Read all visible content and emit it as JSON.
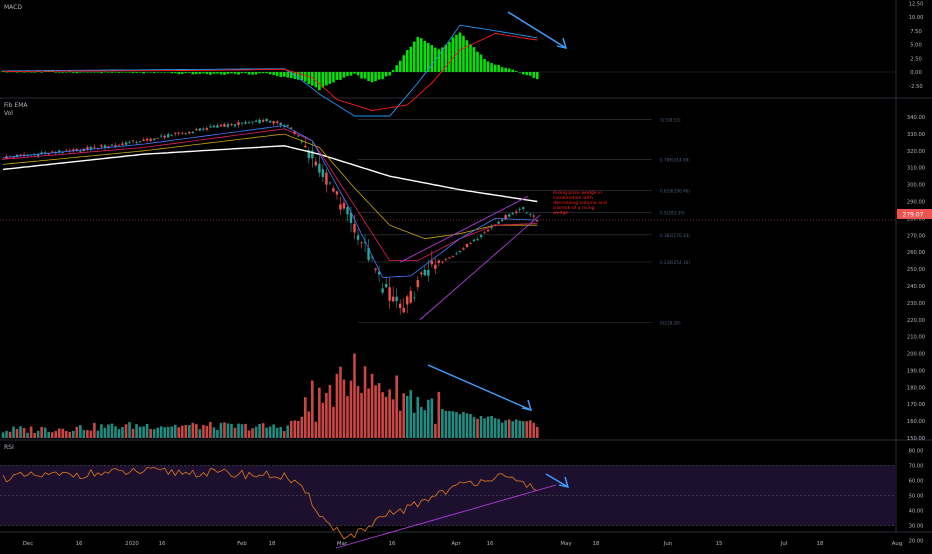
{
  "panes": {
    "macd": {
      "label": "MACD"
    },
    "price": {
      "label": "Fib EMA",
      "sublabel": "Vol"
    },
    "rsi": {
      "label": "RSI"
    }
  },
  "current_price": "279.07",
  "annotation": [
    "Rising price wedge in",
    "combination with",
    "decreasing volume and",
    "a break of a rising",
    "wedge"
  ],
  "fib_levels": [
    {
      "label": "1(338.53)",
      "value": 338.5
    },
    {
      "label": "0.786(314.99)",
      "value": 315.0
    },
    {
      "label": "0.618(296.46)",
      "value": 296.5
    },
    {
      "label": "0.5(283.39)",
      "value": 283.4
    },
    {
      "label": "0.382(270.33)",
      "value": 270.3
    },
    {
      "label": "0.236(254.16)",
      "value": 254.2
    },
    {
      "label": "0(218.26)",
      "value": 218.3
    }
  ],
  "axes": {
    "macd_ticks": [
      "12.50",
      "10.00",
      "7.50",
      "5.00",
      "2.50",
      "0.00",
      "-2.50"
    ],
    "price_ticks": [
      "340.00",
      "330.00",
      "320.00",
      "310.00",
      "300.00",
      "290.00",
      "280.00",
      "270.00",
      "260.00",
      "250.00",
      "240.00",
      "230.00",
      "220.00",
      "210.00",
      "200.00",
      "190.00",
      "180.00",
      "170.00",
      "160.00",
      "150.00"
    ],
    "rsi_ticks": [
      "80.00",
      "70.00",
      "60.00",
      "50.00",
      "40.00",
      "30.00",
      "20.00"
    ],
    "x_ticks": [
      "Dec",
      "16",
      "2020",
      "16",
      "Feb",
      "18",
      "Mar",
      "16",
      "Apr",
      "16",
      "May",
      "18",
      "Jun",
      "15",
      "Jul",
      "18",
      "Aug"
    ]
  },
  "colors": {
    "up": "#26a69a",
    "down": "#ef5350",
    "macd_hist": "#00e500",
    "macd_line": "#2196f3",
    "signal_line": "#ff1a1a",
    "ema_200": "#ffffff",
    "ema_fast": "#4a78ff",
    "ema_mid": "#e91e63",
    "ema_slow": "#c8a800",
    "rsi_line": "#e07a1f",
    "rsi_band": "#1d0f2e",
    "wedge": "#b03cd8",
    "arrow": "#3fa0ff",
    "annotation": "#ff2020"
  },
  "chart_data": {
    "type": "candlestick",
    "scale": {
      "price_range": [
        150,
        343
      ],
      "macd_range": [
        -4,
        13
      ],
      "rsi_range": [
        15,
        85
      ]
    },
    "anchors": {
      "price": [
        [
          0,
          316
        ],
        [
          20,
          320
        ],
        [
          40,
          326
        ],
        [
          60,
          334
        ],
        [
          75,
          338
        ],
        [
          82,
          334
        ],
        [
          90,
          310
        ],
        [
          100,
          276
        ],
        [
          108,
          240
        ],
        [
          114,
          226
        ],
        [
          120,
          248
        ],
        [
          128,
          258
        ],
        [
          136,
          270
        ],
        [
          143,
          281
        ],
        [
          148,
          286
        ],
        [
          152,
          279
        ]
      ],
      "ema200": [
        [
          0,
          309
        ],
        [
          40,
          318
        ],
        [
          80,
          323
        ],
        [
          90,
          318
        ],
        [
          110,
          305
        ],
        [
          130,
          297
        ],
        [
          152,
          290
        ]
      ],
      "ema_slow": [
        [
          0,
          312
        ],
        [
          40,
          320
        ],
        [
          80,
          330
        ],
        [
          90,
          322
        ],
        [
          100,
          298
        ],
        [
          110,
          276
        ],
        [
          120,
          268
        ],
        [
          130,
          271
        ],
        [
          140,
          276
        ],
        [
          152,
          276
        ]
      ],
      "ema_mid": [
        [
          0,
          315
        ],
        [
          40,
          322
        ],
        [
          80,
          333
        ],
        [
          88,
          326
        ],
        [
          98,
          294
        ],
        [
          110,
          255
        ],
        [
          118,
          255
        ],
        [
          130,
          268
        ],
        [
          140,
          276
        ],
        [
          152,
          277
        ]
      ],
      "ema_fast": [
        [
          0,
          316
        ],
        [
          40,
          324
        ],
        [
          80,
          335
        ],
        [
          88,
          326
        ],
        [
          98,
          288
        ],
        [
          108,
          245
        ],
        [
          116,
          246
        ],
        [
          130,
          268
        ],
        [
          140,
          280
        ],
        [
          152,
          279
        ]
      ],
      "volume": [
        [
          0,
          154
        ],
        [
          40,
          157
        ],
        [
          80,
          156
        ],
        [
          88,
          165
        ],
        [
          95,
          178
        ],
        [
          100,
          183
        ],
        [
          110,
          177
        ],
        [
          115,
          173
        ],
        [
          120,
          168
        ],
        [
          130,
          163
        ],
        [
          140,
          160
        ],
        [
          152,
          157
        ]
      ],
      "macd_hist": [
        [
          0,
          0.1
        ],
        [
          45,
          -0.2
        ],
        [
          60,
          -0.4
        ],
        [
          75,
          -0.3
        ],
        [
          85,
          -1.5
        ],
        [
          90,
          -3.2
        ],
        [
          95,
          -1.5
        ],
        [
          100,
          -0.4
        ],
        [
          105,
          -2.0
        ],
        [
          110,
          -0.6
        ],
        [
          118,
          6.5
        ],
        [
          124,
          4.0
        ],
        [
          130,
          7.2
        ],
        [
          138,
          1.8
        ],
        [
          145,
          0.4
        ],
        [
          152,
          -1.2
        ]
      ],
      "macd_line": [
        [
          0,
          0.2
        ],
        [
          60,
          0.5
        ],
        [
          80,
          0.6
        ],
        [
          85,
          -1.5
        ],
        [
          90,
          -4
        ],
        [
          100,
          -8
        ],
        [
          110,
          -8
        ],
        [
          118,
          -2
        ],
        [
          124,
          3
        ],
        [
          130,
          8.5
        ],
        [
          140,
          7.5
        ],
        [
          152,
          6.2
        ]
      ],
      "signal_line": [
        [
          0,
          0.1
        ],
        [
          60,
          0.3
        ],
        [
          80,
          0.5
        ],
        [
          88,
          -1
        ],
        [
          95,
          -5
        ],
        [
          105,
          -7
        ],
        [
          115,
          -6
        ],
        [
          122,
          -2
        ],
        [
          130,
          4
        ],
        [
          140,
          7
        ],
        [
          152,
          5.8
        ]
      ],
      "rsi": [
        [
          0,
          62
        ],
        [
          20,
          64
        ],
        [
          40,
          66
        ],
        [
          60,
          65
        ],
        [
          80,
          63
        ],
        [
          86,
          52
        ],
        [
          92,
          32
        ],
        [
          98,
          22
        ],
        [
          104,
          28
        ],
        [
          110,
          38
        ],
        [
          116,
          42
        ],
        [
          124,
          52
        ],
        [
          132,
          58
        ],
        [
          140,
          63
        ],
        [
          146,
          59
        ],
        [
          152,
          56
        ]
      ]
    }
  }
}
